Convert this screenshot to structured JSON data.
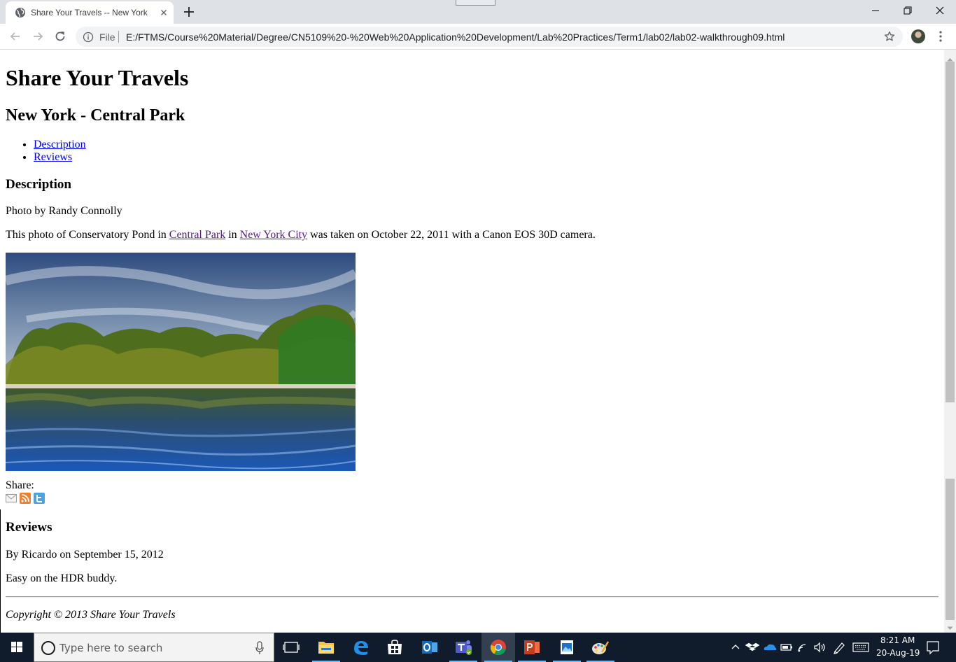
{
  "browser": {
    "tab_title": "Share Your Travels -- New York - Central Park",
    "url_scheme": "File",
    "url": "E:/FTMS/Course%20Material/Degree/CN5109%20-%20Web%20Application%20Development/Lab%20Practices/Term1/lab02/lab02-walkthrough09.html"
  },
  "page": {
    "site_title": "Share Your Travels",
    "heading": "New York - Central Park",
    "toc": [
      "Description",
      "Reviews"
    ],
    "description_heading": "Description",
    "photo_credit": "Photo by Randy Connolly",
    "desc_prefix": "This photo of Conservatory Pond in ",
    "desc_link1": "Central Park",
    "desc_mid": " in ",
    "desc_link2": "New York City",
    "desc_suffix": " was taken on October 22, 2011 with a Canon EOS 30D camera.",
    "share_label": "Share:",
    "share_icons": [
      "email-icon",
      "rss-icon",
      "twitter-icon"
    ],
    "reviews_heading": "Reviews",
    "review_byline": "By Ricardo on September 15, 2012",
    "review_text": "Easy on the HDR buddy.",
    "copyright": "Copyright © 2013 Share Your Travels"
  },
  "taskbar": {
    "search_placeholder": "Type here to search",
    "apps": [
      "task-view",
      "file-explorer",
      "edge",
      "store",
      "outlook",
      "teams",
      "chrome",
      "powerpoint",
      "photos",
      "paint"
    ],
    "time": "8:21 AM",
    "date": "20-Aug-19"
  },
  "colors": {
    "link": "#0000ee",
    "visited": "#551a8b",
    "taskbar": "#101c2c",
    "tabbar": "#dee1e6"
  }
}
